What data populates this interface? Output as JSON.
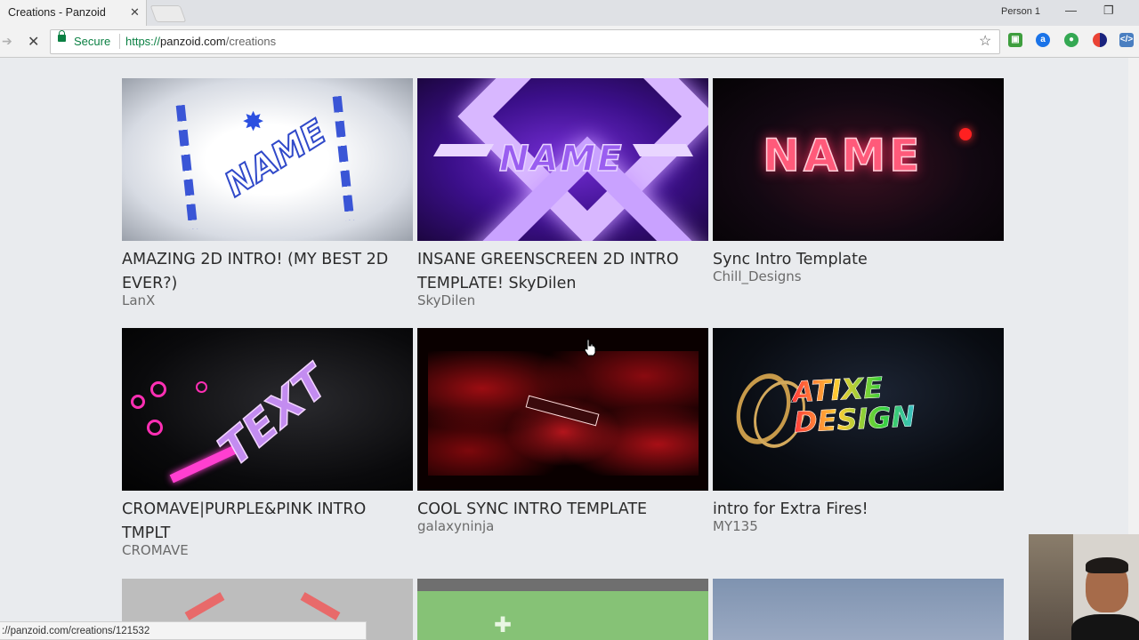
{
  "browser": {
    "tab_title": "Creations - Panzoid",
    "tab_close": "✕",
    "profile": "Person 1",
    "minimize": "—",
    "restore": "❐",
    "secure_label": "Secure",
    "url_scheme": "https://",
    "url_host": "panzoid.com",
    "url_path": "/creations",
    "status_url": "://panzoid.com/creations/121532"
  },
  "creations": [
    {
      "title": "AMAZING 2D INTRO! (MY BEST 2D EVER?)",
      "author": "LanX",
      "thumb_text": "NAME"
    },
    {
      "title": "INSANE GREENSCREEN 2D INTRO TEMPLATE! SkyDilen",
      "author": "SkyDilen",
      "thumb_text": "NAME"
    },
    {
      "title": "Sync Intro Template",
      "author": "Chill_Designs",
      "thumb_text": "NAME"
    },
    {
      "title": "CROMAVE|PURPLE&PINK INTRO TMPLT",
      "author": "CROMAVE",
      "thumb_text": "TEXT"
    },
    {
      "title": "COOL SYNC INTRO TEMPLATE",
      "author": "galaxyninja",
      "thumb_text": ""
    },
    {
      "title": "intro for Extra Fires!",
      "author": "MY135",
      "thumb_text": "ATIXE DESIGN"
    }
  ],
  "colors": {
    "secure_green": "#0b8043",
    "page_bg": "#e9ebee"
  }
}
